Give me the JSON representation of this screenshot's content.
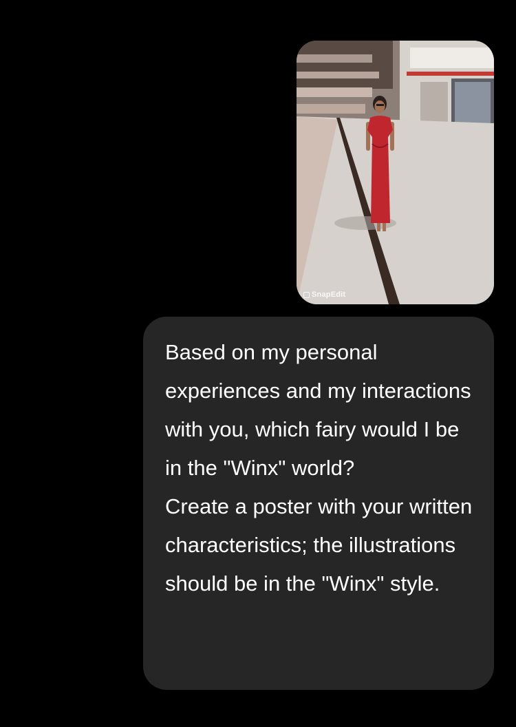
{
  "conversation": {
    "attachment": {
      "description_icon": "photo-attachment",
      "watermark": "SnapEdit"
    },
    "message": {
      "text": "Based on my personal experiences and my interactions with you, which fairy would I be in the \"Winx\" world?\nCreate a poster with your written characteristics; the illustrations should be in the \"Winx\" style."
    }
  },
  "colors": {
    "background": "#000000",
    "bubble": "#262626",
    "text": "#ffffff",
    "dress": "#c0262e"
  }
}
